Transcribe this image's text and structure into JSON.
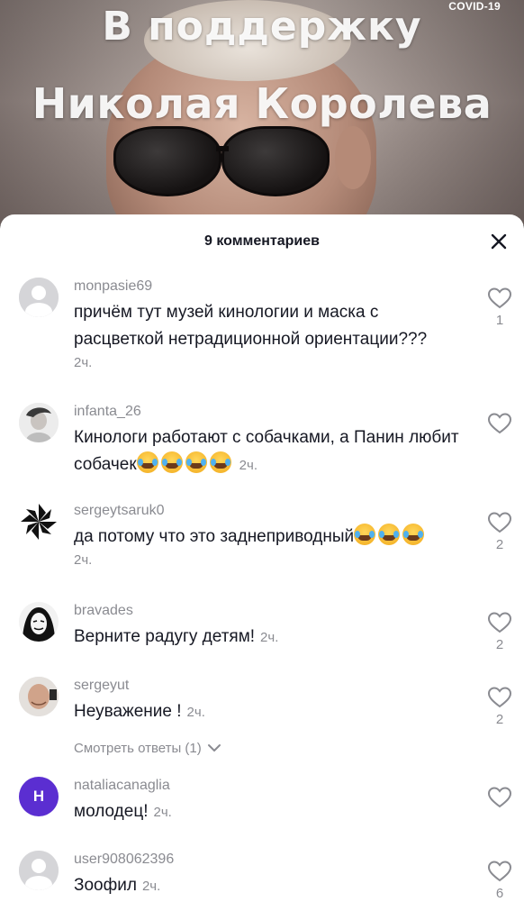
{
  "video": {
    "caption_line1": "В поддержку",
    "caption_line2": "Николая Королева",
    "badge": "COVID-19"
  },
  "sheet": {
    "title": "9 комментариев",
    "close_icon": "close-icon"
  },
  "comments": [
    {
      "username": "monpasie69",
      "text": "причём тут музей кинологии и маска с расцветкой нетрадиционной ориентации???",
      "time": "2ч.",
      "likes": "1"
    },
    {
      "username": "infanta_26",
      "text": "Кинологи работают с собачками, а Панин любит собачек",
      "emojis": [
        "face-with-tears-of-joy",
        "face-with-tears-of-joy",
        "face-with-tears-of-joy",
        "face-with-tears-of-joy"
      ],
      "time": "2ч.",
      "likes": ""
    },
    {
      "username": "sergeytsaruk0",
      "text": "да потому что это заднеприводный",
      "emojis": [
        "face-with-tears-of-joy",
        "face-with-tears-of-joy",
        "face-with-tears-of-joy"
      ],
      "time": "2ч.",
      "likes": "2"
    },
    {
      "username": "bravades",
      "text": "Верните радугу детям!",
      "time": "2ч.",
      "likes": "2"
    },
    {
      "username": "sergeyut",
      "text": "Неуважение !",
      "time": "2ч.",
      "likes": "2",
      "replies": "Смотреть ответы (1)"
    },
    {
      "username": "nataliacanaglia",
      "avatar_letter": "Н",
      "text": "молодец!",
      "time": "2ч.",
      "likes": ""
    },
    {
      "username": "user908062396",
      "text": "Зоофил",
      "time": "2ч.",
      "likes": "6"
    }
  ],
  "colors": {
    "text_primary": "#161823",
    "text_secondary": "#8a8b91",
    "avatar_purple": "#5b2ed1"
  }
}
